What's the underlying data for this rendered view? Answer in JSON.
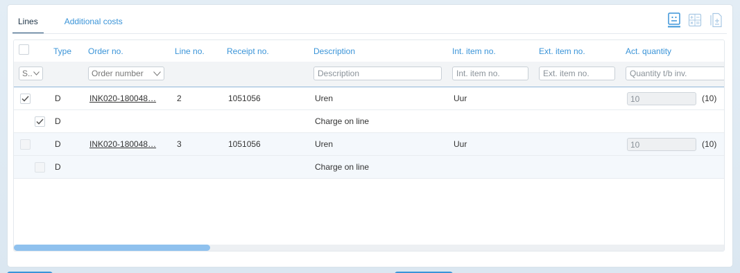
{
  "tabs": [
    {
      "label": "Lines",
      "active": true
    },
    {
      "label": "Additional costs",
      "active": false
    }
  ],
  "toolbar": {
    "icons": [
      "row-view-icon",
      "calculator-icon",
      "document-add-icon"
    ],
    "accent": "#3a94d8"
  },
  "grid": {
    "columns": [
      "Type",
      "Order no.",
      "Line no.",
      "Receipt no.",
      "Description",
      "Int. item no.",
      "Ext. item no.",
      "Act. quantity"
    ],
    "filters": {
      "status_value": "S..",
      "order_placeholder": "Order number",
      "description_placeholder": "Description",
      "int_item_placeholder": "Int. item no.",
      "ext_item_placeholder": "Ext. item no.",
      "qty_placeholder": "Quantity t/b inv."
    },
    "rows": [
      {
        "checked": true,
        "type": "D",
        "order": "INK020-180048…",
        "line": "2",
        "receipt": "1051056",
        "description": "Uren",
        "int_item": "Uur",
        "qty": "10",
        "qty_total": "(10)"
      },
      {
        "checked": true,
        "type": "D",
        "order": "",
        "line": "",
        "receipt": "",
        "description": "Charge on line",
        "int_item": "",
        "qty": "",
        "qty_total": ""
      },
      {
        "checked": false,
        "type": "D",
        "order": "INK020-180048…",
        "line": "3",
        "receipt": "1051056",
        "description": "Uren",
        "int_item": "Uur",
        "qty": "10",
        "qty_total": "(10)"
      },
      {
        "checked": false,
        "type": "D",
        "order": "",
        "line": "",
        "receipt": "",
        "description": "Charge on line",
        "int_item": "",
        "qty": "",
        "qty_total": ""
      }
    ],
    "scroll_position": 0
  }
}
